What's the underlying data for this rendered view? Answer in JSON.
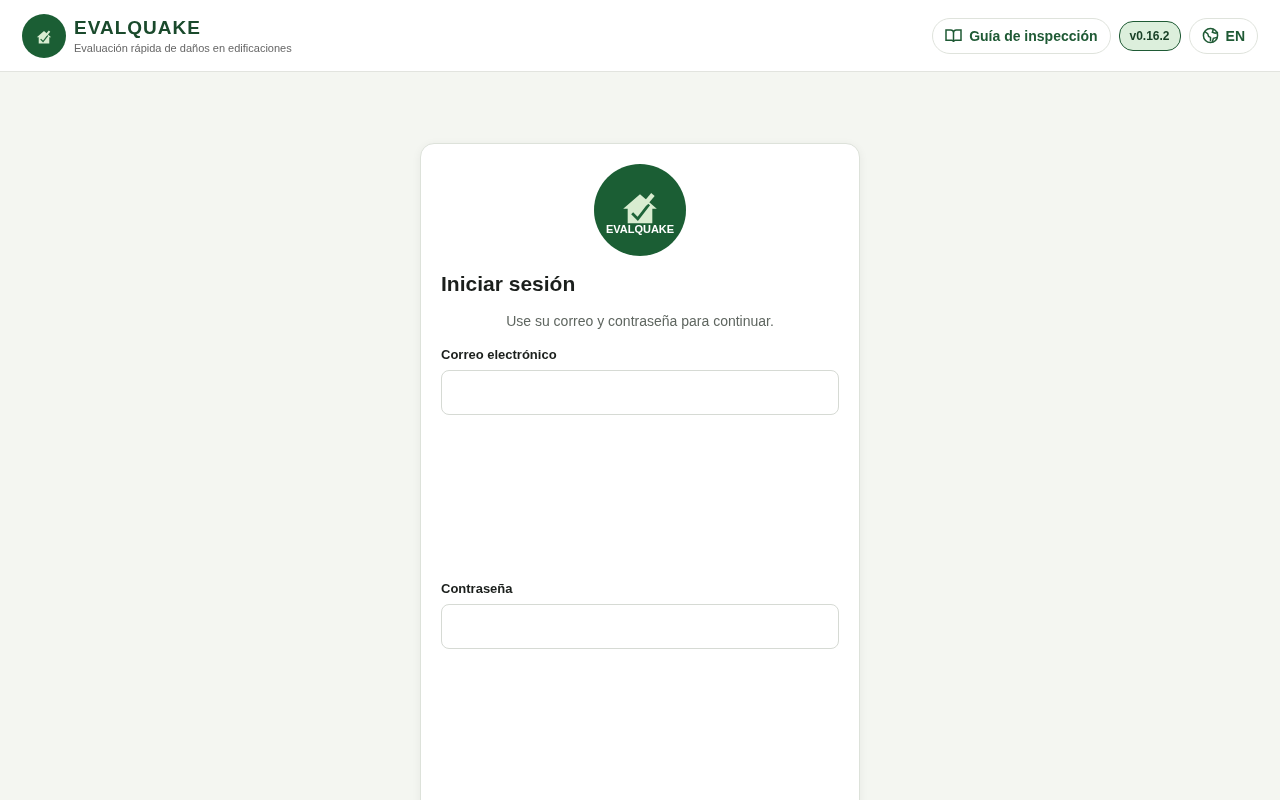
{
  "header": {
    "title": "EVALQUAKE",
    "subtitle": "Evaluación rápida de daños en edificaciones",
    "guide_button": "Guía de inspección",
    "version": "v0.16.2",
    "language_button": "EN"
  },
  "login": {
    "logo_text": "EVALQUAKE",
    "title": "Iniciar sesión",
    "description": "Use su correo y contraseña para continuar.",
    "fields": [
      {
        "label": "Correo electrónico"
      },
      {
        "label": "Contraseña"
      }
    ]
  }
}
